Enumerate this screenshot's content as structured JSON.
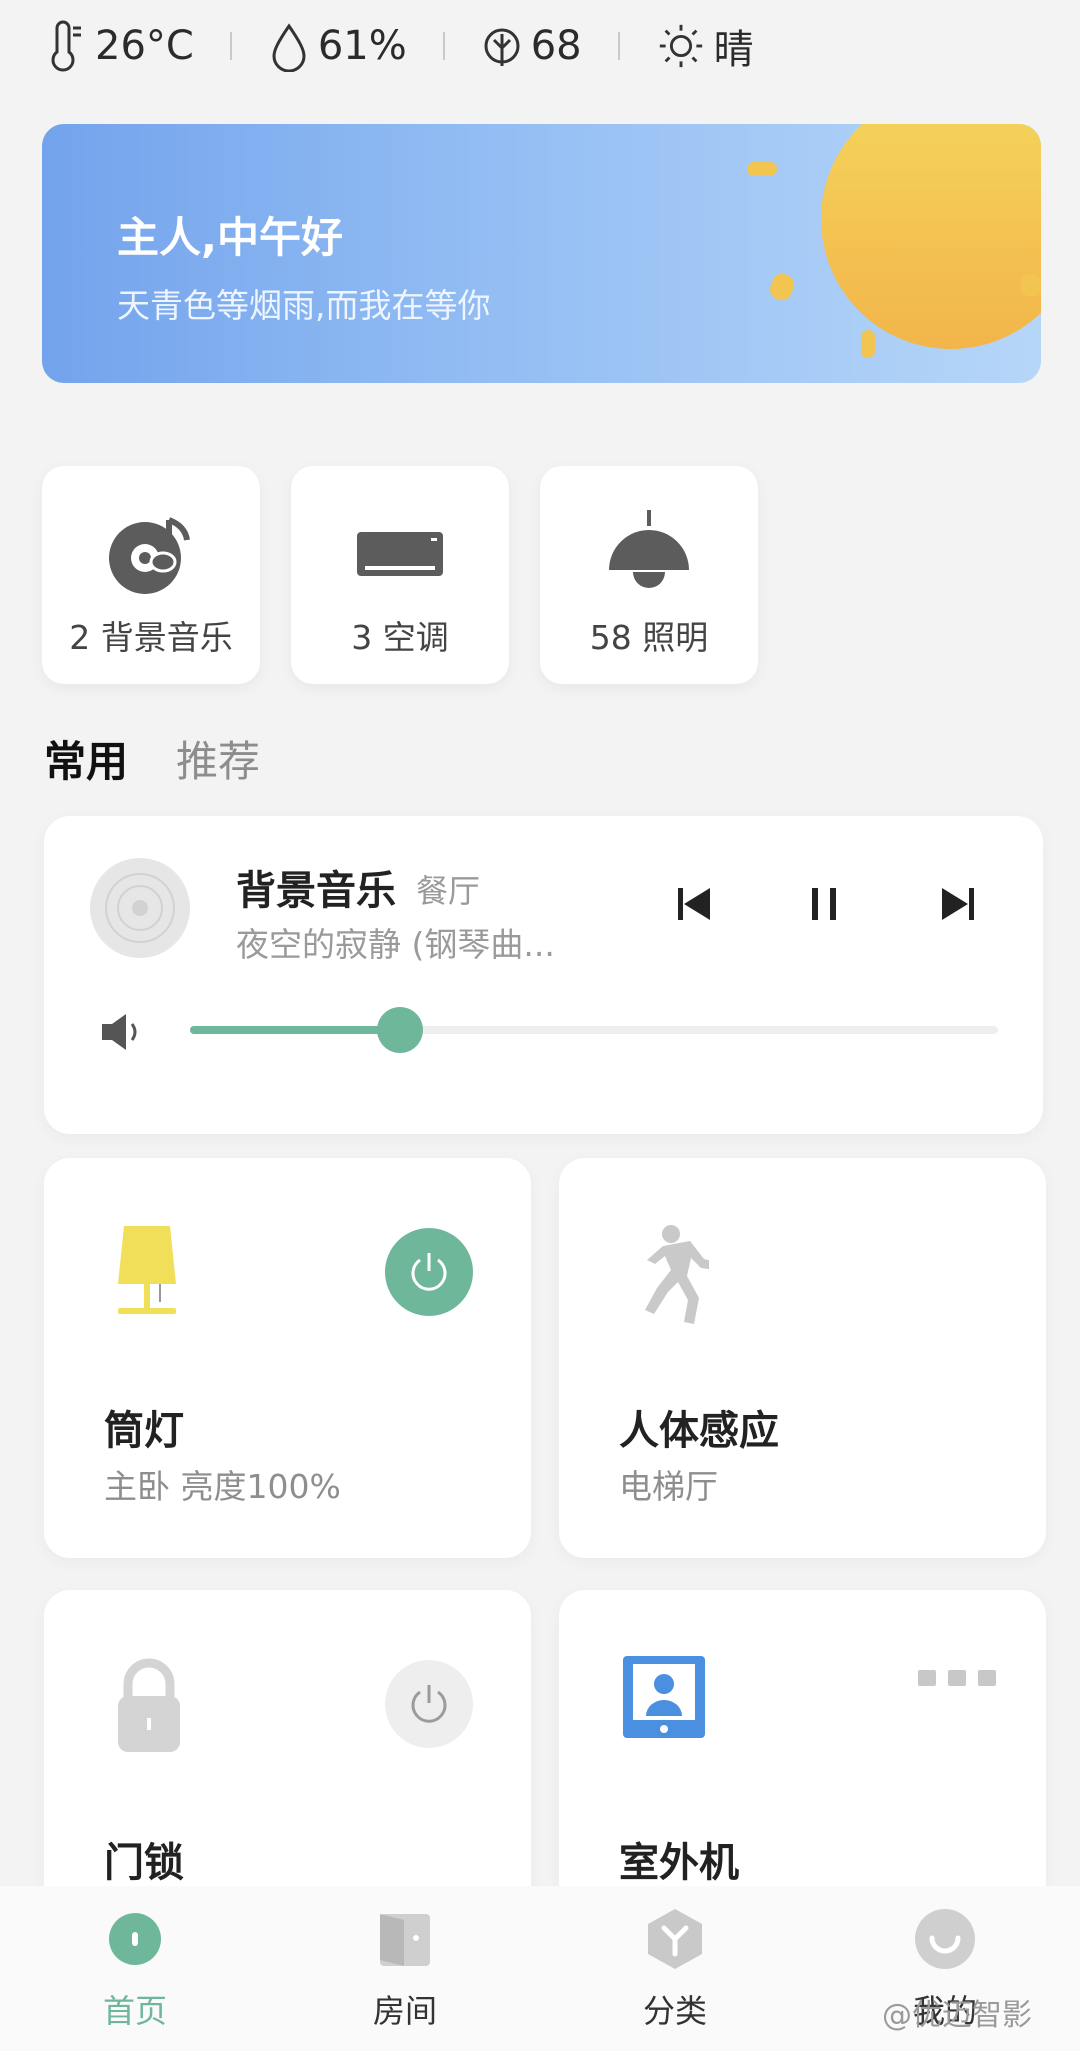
{
  "status": {
    "temperature": "26°C",
    "humidity": "61%",
    "air_quality": "68",
    "weather": "晴"
  },
  "banner": {
    "greeting": "主人,中午好",
    "subtitle": "天青色等烟雨,而我在等你"
  },
  "categories": [
    {
      "label": "2 背景音乐",
      "icon": "music-disc-icon"
    },
    {
      "label": "3 空调",
      "icon": "air-conditioner-icon"
    },
    {
      "label": "58 照明",
      "icon": "pendant-lamp-icon"
    }
  ],
  "tabs": [
    {
      "label": "常用",
      "active": true
    },
    {
      "label": "推荐",
      "active": false
    }
  ],
  "music": {
    "title": "背景音乐",
    "room": "餐厅",
    "song": "夜空的寂静 (钢琴曲...",
    "volume_fraction": 0.26
  },
  "devices": [
    {
      "name": "筒灯",
      "desc": "主卧 亮度100%",
      "icon": "table-lamp-icon",
      "power": "on"
    },
    {
      "name": "人体感应",
      "desc": "电梯厅",
      "icon": "running-person-icon",
      "power": null
    },
    {
      "name": "门锁",
      "desc": "",
      "icon": "padlock-icon",
      "power": "off"
    },
    {
      "name": "室外机",
      "desc": "",
      "icon": "video-intercom-icon",
      "power": null
    }
  ],
  "nav": [
    {
      "label": "首页",
      "icon": "home-icon",
      "active": true
    },
    {
      "label": "房间",
      "icon": "door-icon",
      "active": false
    },
    {
      "label": "分类",
      "icon": "category-cube-icon",
      "active": false
    },
    {
      "label": "我的",
      "icon": "profile-smile-icon",
      "active": false
    }
  ],
  "watermark": "@优迈智影",
  "colors": {
    "accent": "#6fb79b",
    "banner_start": "#73a3ec",
    "banner_end": "#b6d6f8",
    "lamp_yellow": "#f1df5a",
    "intercom_blue": "#4a8fe0"
  }
}
